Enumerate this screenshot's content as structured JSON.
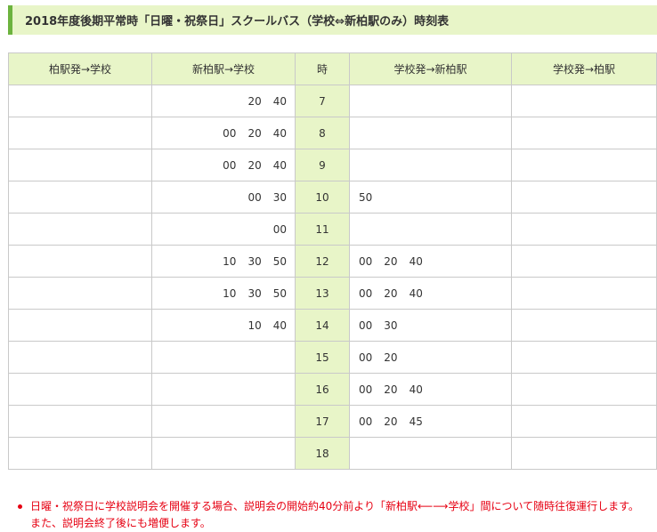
{
  "page": {
    "title": "2018年度後期平常時「日曜・祝祭日」スクールバス（学校⇔新柏駅のみ）時刻表"
  },
  "table": {
    "headers": [
      "柏駅発→学校",
      "新柏駅→学校",
      "時",
      "学校発→新柏駅",
      "学校発→柏駅"
    ],
    "rows": [
      {
        "hour": "7",
        "kashiwa_to_school": [],
        "shinkashiwa_to_school": [
          "20",
          "40"
        ],
        "school_to_shinkashiwa": [],
        "school_to_kashiwa": []
      },
      {
        "hour": "8",
        "kashiwa_to_school": [],
        "shinkashiwa_to_school": [
          "00",
          "20",
          "40"
        ],
        "school_to_shinkashiwa": [],
        "school_to_kashiwa": []
      },
      {
        "hour": "9",
        "kashiwa_to_school": [],
        "shinkashiwa_to_school": [
          "00",
          "20",
          "40"
        ],
        "school_to_shinkashiwa": [],
        "school_to_kashiwa": []
      },
      {
        "hour": "10",
        "kashiwa_to_school": [],
        "shinkashiwa_to_school": [
          "00",
          "30"
        ],
        "school_to_shinkashiwa": [
          "50"
        ],
        "school_to_kashiwa": []
      },
      {
        "hour": "11",
        "kashiwa_to_school": [],
        "shinkashiwa_to_school": [
          "00"
        ],
        "school_to_shinkashiwa": [],
        "school_to_kashiwa": []
      },
      {
        "hour": "12",
        "kashiwa_to_school": [],
        "shinkashiwa_to_school": [
          "10",
          "30",
          "50"
        ],
        "school_to_shinkashiwa": [
          "00",
          "20",
          "40"
        ],
        "school_to_kashiwa": []
      },
      {
        "hour": "13",
        "kashiwa_to_school": [],
        "shinkashiwa_to_school": [
          "10",
          "30",
          "50"
        ],
        "school_to_shinkashiwa": [
          "00",
          "20",
          "40"
        ],
        "school_to_kashiwa": []
      },
      {
        "hour": "14",
        "kashiwa_to_school": [],
        "shinkashiwa_to_school": [
          "10",
          "40"
        ],
        "school_to_shinkashiwa": [
          "00",
          "30"
        ],
        "school_to_kashiwa": []
      },
      {
        "hour": "15",
        "kashiwa_to_school": [],
        "shinkashiwa_to_school": [],
        "school_to_shinkashiwa": [
          "00",
          "20"
        ],
        "school_to_kashiwa": []
      },
      {
        "hour": "16",
        "kashiwa_to_school": [],
        "shinkashiwa_to_school": [],
        "school_to_shinkashiwa": [
          "00",
          "20",
          "40"
        ],
        "school_to_kashiwa": []
      },
      {
        "hour": "17",
        "kashiwa_to_school": [],
        "shinkashiwa_to_school": [],
        "school_to_shinkashiwa": [
          "00",
          "20",
          "45"
        ],
        "school_to_kashiwa": []
      },
      {
        "hour": "18",
        "kashiwa_to_school": [],
        "shinkashiwa_to_school": [],
        "school_to_shinkashiwa": [],
        "school_to_kashiwa": []
      }
    ]
  },
  "notes": [
    "日曜・祝祭日に学校説明会を開催する場合、説明会の開始約40分前より「新柏駅⟵⟶学校」間について随時往復運行します。また、説明会終了後にも増便します。"
  ],
  "colors": {
    "header_bg": "#e8f5c8",
    "accent": "#6cb33e",
    "note_text": "#e60012",
    "border": "#c9c9c9"
  }
}
